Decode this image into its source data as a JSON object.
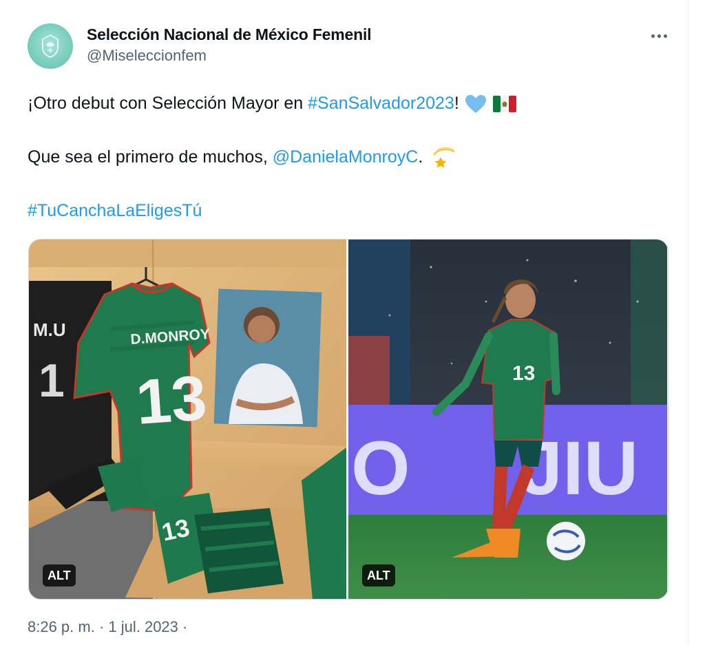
{
  "tweet": {
    "author": {
      "display_name": "Selección Nacional de México Femenil",
      "handle": "@Miseleccionfem",
      "avatar_color": "#7ccfbf"
    },
    "text": {
      "line1_prefix": "¡Otro debut con Selección Mayor en ",
      "line1_hashtag": "#SanSalvador2023",
      "line1_suffix": "!",
      "line2_prefix": "Que sea el primero de muchos, ",
      "line2_mention": "@DanielaMonroyC",
      "line2_suffix": ".",
      "line3_hashtag": "#TuCanchaLaEligesTú"
    },
    "emojis": [
      "blue-heart",
      "mexico-flag",
      "dizzy-star"
    ],
    "media": {
      "left": {
        "jersey_name": "D.MONROY",
        "jersey_number": "13",
        "alt_label": "ALT"
      },
      "right": {
        "jersey_number": "13",
        "alt_label": "ALT"
      }
    },
    "timestamp": "8:26 p. m. · 1 jul. 2023 ·"
  },
  "colors": {
    "link": "#1d9bf0",
    "secondary_text": "#536471",
    "jersey_green": "#1e7a4f"
  }
}
